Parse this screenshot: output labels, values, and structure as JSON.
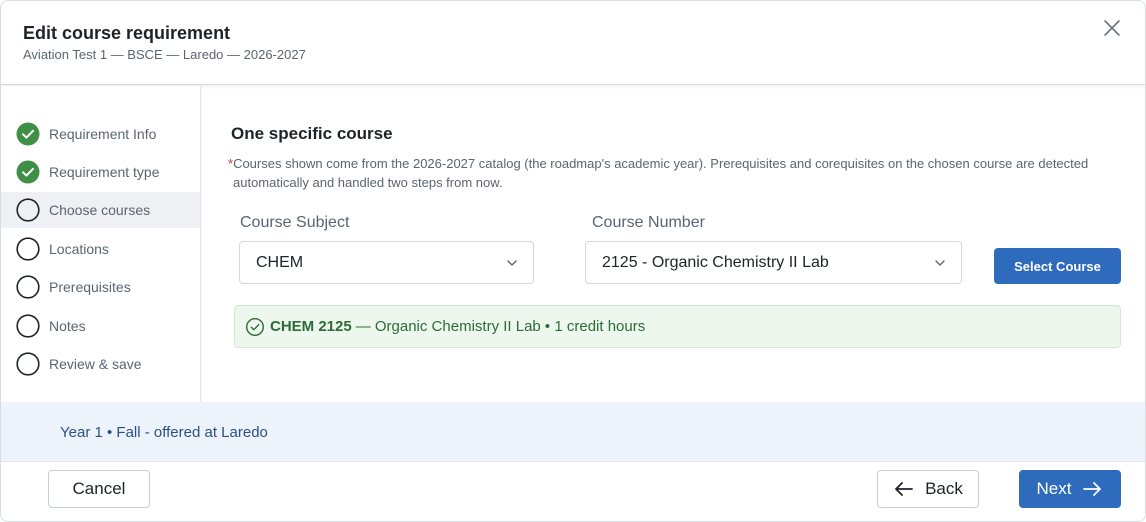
{
  "header": {
    "title": "Edit course requirement",
    "subtitle": "Aviation Test 1 — BSCE — Laredo — 2026-2027",
    "close_icon": "close-icon"
  },
  "steps": [
    {
      "label": "Requirement Info",
      "status": "complete"
    },
    {
      "label": "Requirement type",
      "status": "complete"
    },
    {
      "label": "Choose courses",
      "status": "active"
    },
    {
      "label": "Locations",
      "status": "pending"
    },
    {
      "label": "Prerequisites",
      "status": "pending"
    },
    {
      "label": "Notes",
      "status": "pending"
    },
    {
      "label": "Review & save",
      "status": "pending"
    }
  ],
  "content": {
    "section_title": "One specific course",
    "note_star": "*",
    "note_line1": "Courses shown come from the 2026-2027 catalog (the roadmap's academic year). Prerequisites and corequisites on the chosen course are detected",
    "note_line2": "automatically and handled two steps from now.",
    "subject_label": "Course Subject",
    "subject_value": "CHEM",
    "number_label": "Course Number",
    "number_value": "2125 - Organic Chemistry II Lab",
    "select_button": "Select Course",
    "selected": {
      "code": "CHEM 2125",
      "rest": "— Organic Chemistry II Lab • 1 credit hours"
    }
  },
  "info_bar": {
    "text": "Year 1 • Fall - offered at Laredo"
  },
  "footer": {
    "cancel": "Cancel",
    "back": "Back",
    "next": "Next"
  },
  "colors": {
    "primary": "#2f6bbd",
    "success": "#3f8f47",
    "success_bg": "#edf7ee",
    "info_bg": "#edf3fa"
  }
}
